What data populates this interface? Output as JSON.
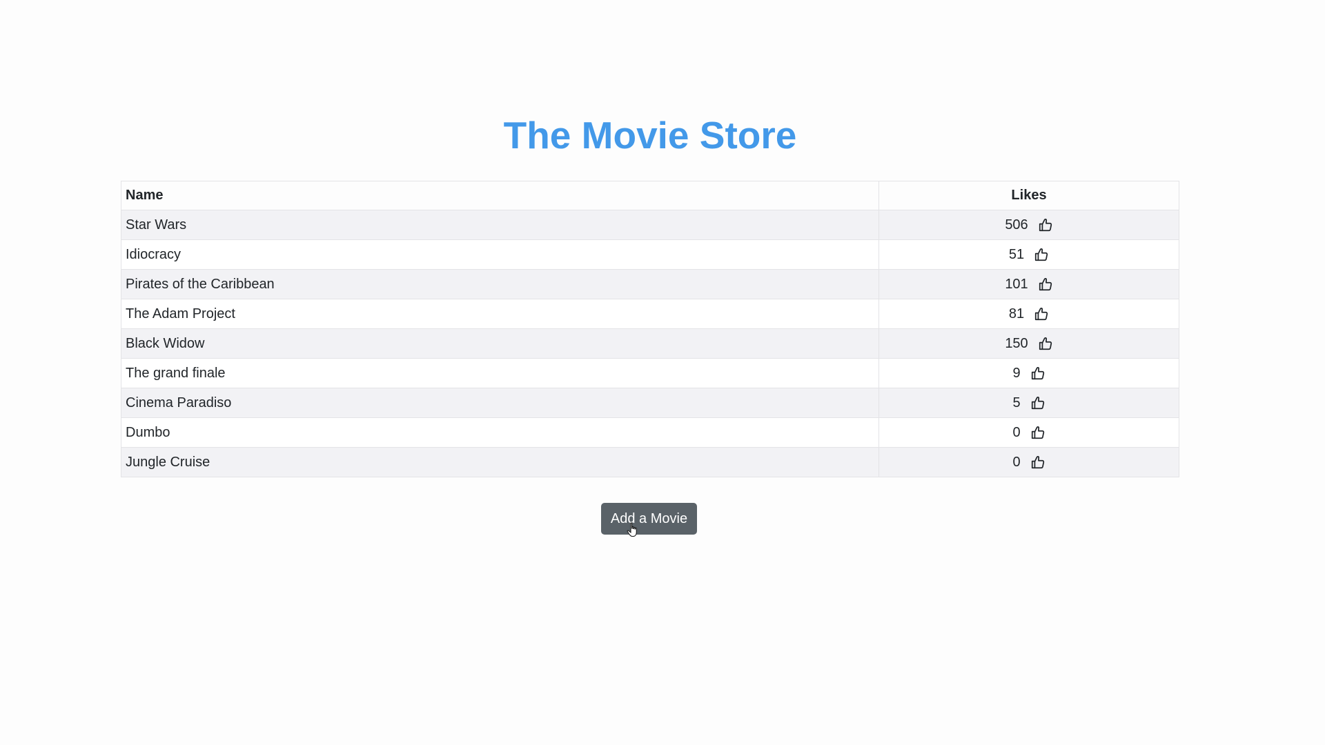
{
  "page": {
    "title": "The Movie Store"
  },
  "table": {
    "headers": {
      "name": "Name",
      "likes": "Likes"
    },
    "rows": [
      {
        "name": "Star Wars",
        "likes": "506"
      },
      {
        "name": "Idiocracy",
        "likes": "51"
      },
      {
        "name": "Pirates of the Caribbean",
        "likes": "101"
      },
      {
        "name": "The Adam Project",
        "likes": "81"
      },
      {
        "name": "Black Widow",
        "likes": "150"
      },
      {
        "name": "The grand finale",
        "likes": "9"
      },
      {
        "name": "Cinema Paradiso",
        "likes": "5"
      },
      {
        "name": "Dumbo",
        "likes": "0"
      },
      {
        "name": "Jungle Cruise",
        "likes": "0"
      }
    ],
    "like_icon": "thumbs-up-icon"
  },
  "actions": {
    "add_movie_label": "Add a Movie"
  },
  "colors": {
    "title": "#4399e9",
    "button_bg": "#5a6268",
    "row_stripe": "#f2f2f5"
  }
}
